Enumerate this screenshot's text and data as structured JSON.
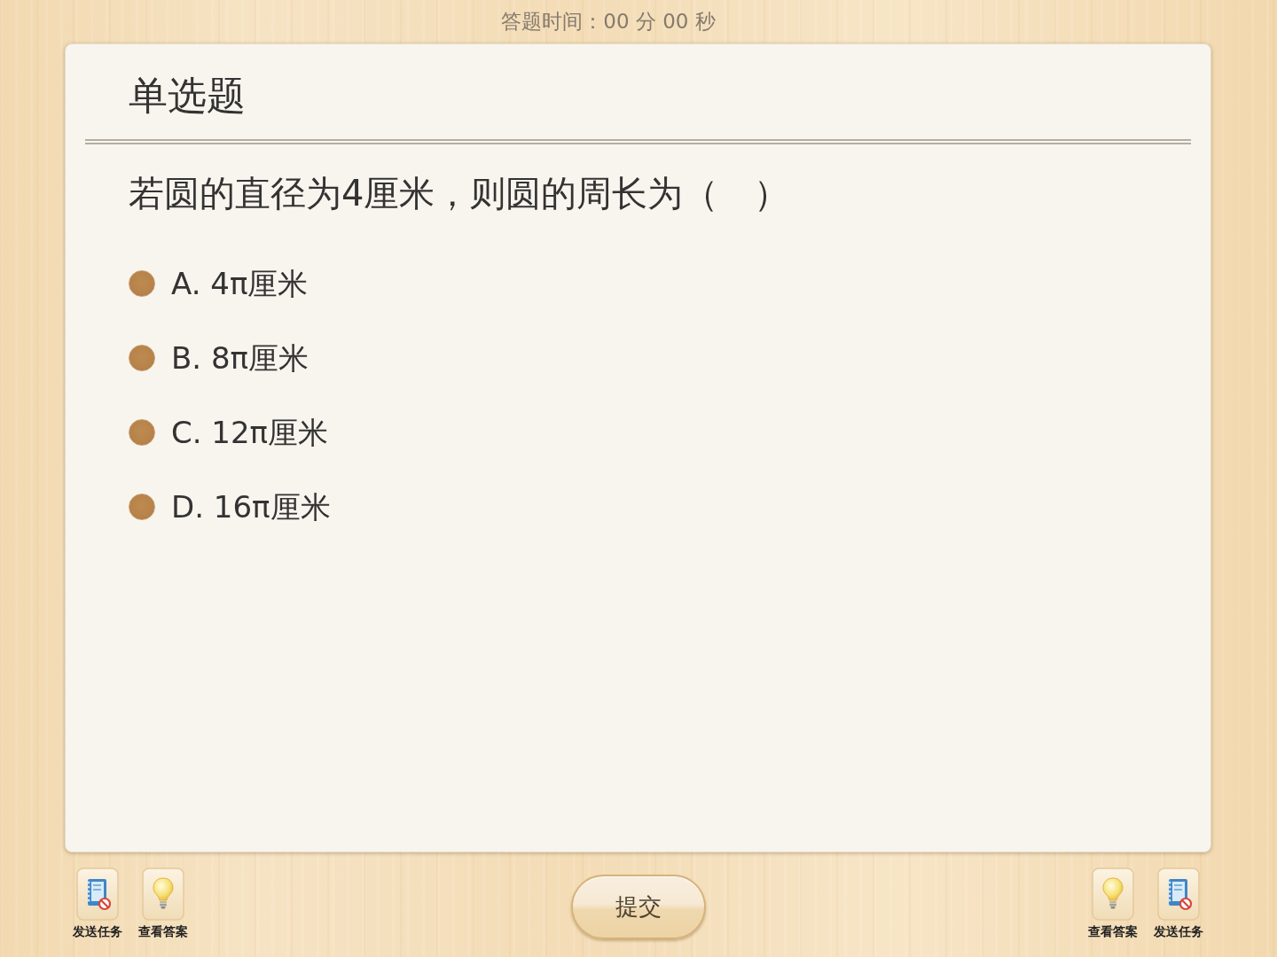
{
  "timer": "答题时间：00 分 00 秒",
  "question_type": "单选题",
  "question": "若圆的直径为4厘米，则圆的周长为（　）",
  "options": [
    {
      "label": "A. 4π厘米",
      "selected": false
    },
    {
      "label": "B. 8π厘米",
      "selected": false
    },
    {
      "label": "C. 12π厘米",
      "selected": false
    },
    {
      "label": "D. 16π厘米",
      "selected": false
    }
  ],
  "left_tools": [
    {
      "kind": "send_task",
      "label": "发送任务"
    },
    {
      "kind": "view_answer",
      "label": "查看答案"
    }
  ],
  "submit_button": "提交",
  "right_tools": [
    {
      "kind": "view_answer",
      "label": "查看答案"
    },
    {
      "kind": "send_task",
      "label": "发送任务"
    }
  ]
}
